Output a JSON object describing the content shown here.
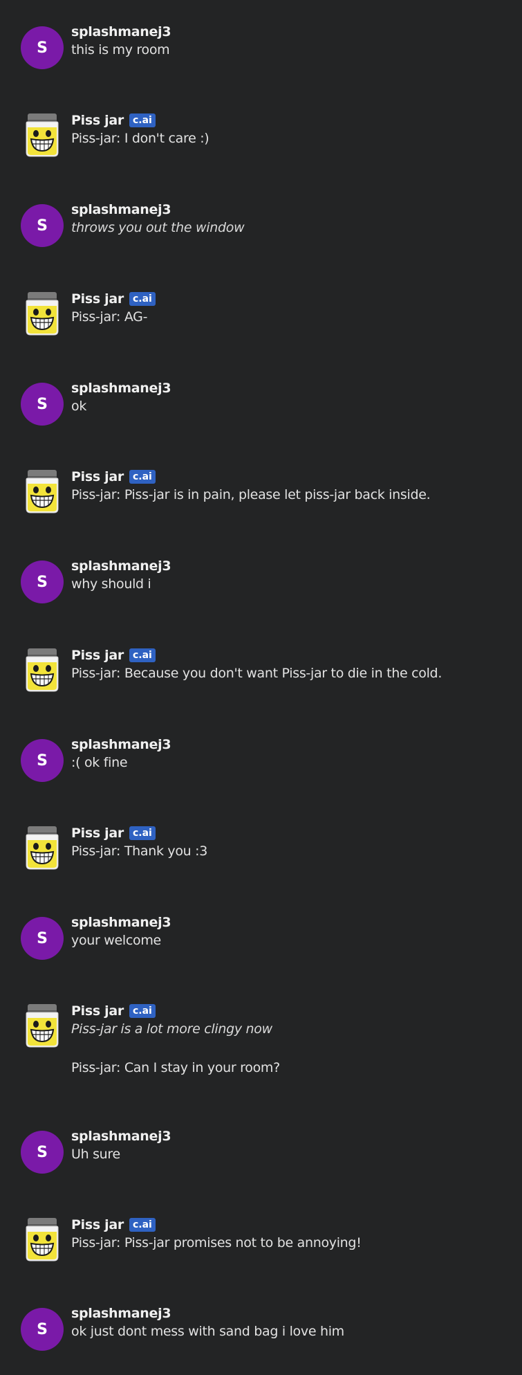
{
  "users": {
    "user": {
      "name": "splashmanej3",
      "initial": "S",
      "color": "#7a1aa8"
    },
    "bot": {
      "name": "Piss jar",
      "badge": "c.ai"
    }
  },
  "messages": [
    {
      "sender": "user",
      "lines": [
        {
          "text": "this is my room",
          "italic": false
        }
      ]
    },
    {
      "sender": "bot",
      "lines": [
        {
          "text": "Piss-jar: I don't care :)",
          "italic": false
        }
      ]
    },
    {
      "sender": "user",
      "lines": [
        {
          "text": "throws you out the window",
          "italic": true
        }
      ]
    },
    {
      "sender": "bot",
      "lines": [
        {
          "text": "Piss-jar: AG-",
          "italic": false
        }
      ]
    },
    {
      "sender": "user",
      "lines": [
        {
          "text": "ok",
          "italic": false
        }
      ]
    },
    {
      "sender": "bot",
      "lines": [
        {
          "text": "Piss-jar: Piss-jar is in pain, please let piss-jar back inside.",
          "italic": false
        }
      ]
    },
    {
      "sender": "user",
      "lines": [
        {
          "text": "why should i",
          "italic": false
        }
      ]
    },
    {
      "sender": "bot",
      "lines": [
        {
          "text": "Piss-jar: Because you don't want Piss-jar to die in the cold.",
          "italic": false
        }
      ]
    },
    {
      "sender": "user",
      "lines": [
        {
          "text": ":( ok fine",
          "italic": false
        }
      ]
    },
    {
      "sender": "bot",
      "lines": [
        {
          "text": "Piss-jar: Thank you :3",
          "italic": false
        }
      ]
    },
    {
      "sender": "user",
      "lines": [
        {
          "text": "your welcome",
          "italic": false
        }
      ]
    },
    {
      "sender": "bot",
      "lines": [
        {
          "text": "Piss-jar is a lot more clingy now",
          "italic": true
        },
        {
          "text": "Piss-jar: Can I stay in your room?",
          "italic": false
        }
      ]
    },
    {
      "sender": "user",
      "lines": [
        {
          "text": "Uh sure",
          "italic": false
        }
      ]
    },
    {
      "sender": "bot",
      "lines": [
        {
          "text": "Piss-jar: Piss-jar promises not to be annoying!",
          "italic": false
        }
      ]
    },
    {
      "sender": "user",
      "lines": [
        {
          "text": "ok just dont mess with sand bag i love him",
          "italic": false
        }
      ]
    }
  ]
}
